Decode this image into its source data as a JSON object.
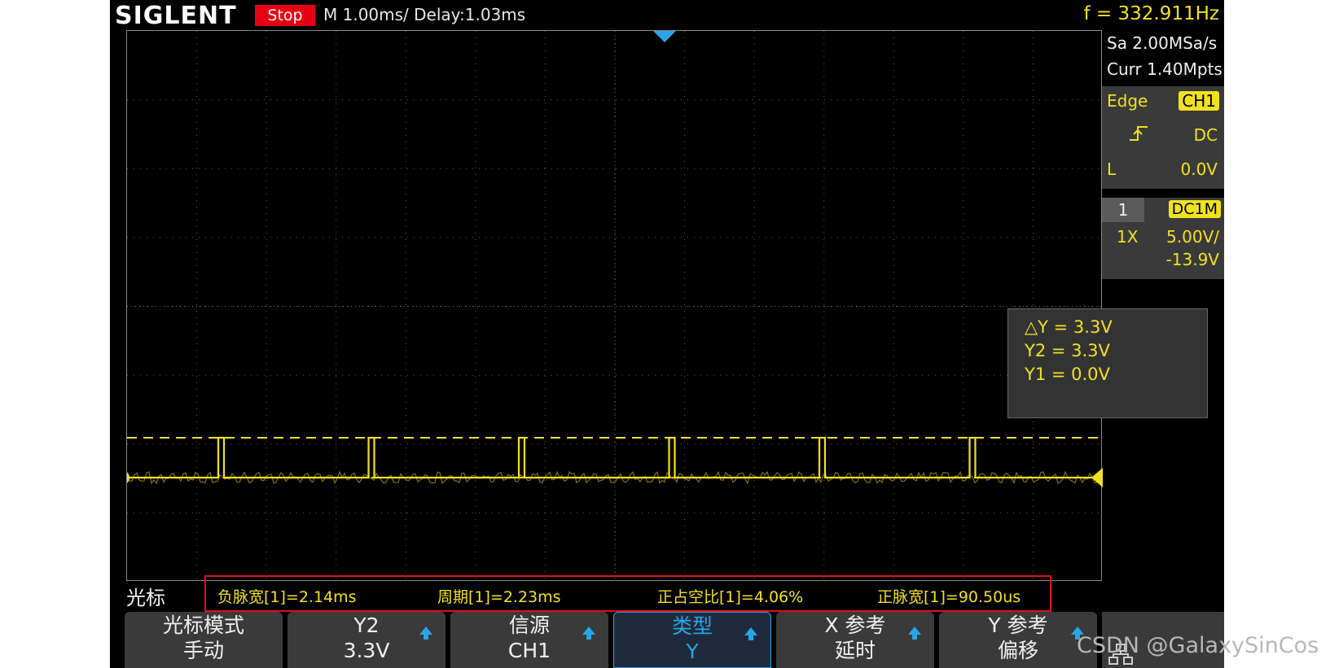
{
  "header": {
    "brand": "SIGLENT",
    "run_state": "Stop",
    "timebase": "M 1.00ms/ Delay:1.03ms",
    "frequency": "f = 332.911Hz"
  },
  "acquisition": {
    "sample_rate": "Sa 2.00MSa/s",
    "memory_depth": "Curr 1.40Mpts"
  },
  "trigger": {
    "type": "Edge",
    "source": "CH1",
    "slope_icon": "rising-edge-icon",
    "coupling": "DC",
    "level_label": "L",
    "level": "0.0V"
  },
  "channel1": {
    "number": "1",
    "coupling": "DC1M",
    "probe": "1X",
    "scale": "5.00V/",
    "offset": "-13.9V",
    "color": "#f2e21e"
  },
  "cursor_readout": {
    "delta_y": "△Y = 3.3V",
    "y2": "Y2 = 3.3V",
    "y1": "Y1 = 0.0V"
  },
  "measurements": {
    "section_label": "光标",
    "items": [
      "负脉宽[1]=2.14ms",
      "周期[1]=2.23ms",
      "正占空比[1]=4.06%",
      "正脉宽[1]=90.50us"
    ]
  },
  "menu": {
    "buttons": [
      {
        "top": "光标模式",
        "bottom": "手动",
        "has_arrow": false,
        "active": false
      },
      {
        "top": "Y2",
        "bottom": "3.3V",
        "has_arrow": true,
        "active": false
      },
      {
        "top": "信源",
        "bottom": "CH1",
        "has_arrow": true,
        "active": false
      },
      {
        "top": "类型",
        "bottom": "Y",
        "has_arrow": true,
        "active": true
      },
      {
        "top": "X 参考",
        "bottom": "延时",
        "has_arrow": true,
        "active": false
      },
      {
        "top": "Y 参考",
        "bottom": "偏移",
        "has_arrow": true,
        "active": false
      }
    ],
    "extra_icon": "network-icon"
  },
  "waveform": {
    "channel_marker": "1",
    "pulse_count": 6
  },
  "watermark": "CSDN @GalaxySinCos",
  "colors": {
    "trace": "#f2e21e",
    "accent": "#2aa4e6",
    "stop": "#e60012"
  }
}
